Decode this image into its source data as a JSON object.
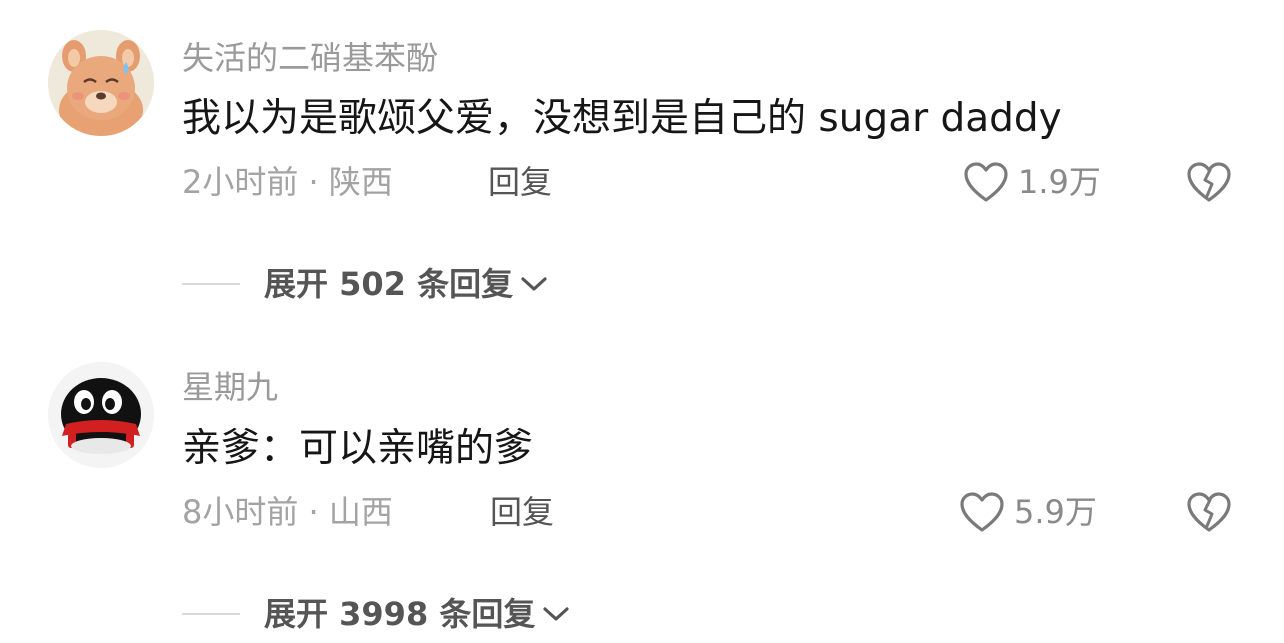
{
  "comments": [
    {
      "username": "失活的二硝基苯酚",
      "content": "我以为是歌颂父爱，没想到是自己的 sugar daddy",
      "meta": "2小时前 · 陕西",
      "reply_label": "回复",
      "likes": "1.9万",
      "expand_label": "展开 502 条回复",
      "avatar_icon": "bear-avatar-icon"
    },
    {
      "username": "星期九",
      "content": "亲爹：可以亲嘴的爹",
      "meta": "8小时前 · 山西",
      "reply_label": "回复",
      "likes": "5.9万",
      "expand_label": "展开 3998 条回复",
      "avatar_icon": "penguin-avatar-icon"
    }
  ],
  "colors": {
    "username": "#9a9a9a",
    "content": "#161616",
    "meta": "#a3a3a3",
    "action": "#555555",
    "icon": "#7a7a7a",
    "divider": "#d9d9d9"
  }
}
